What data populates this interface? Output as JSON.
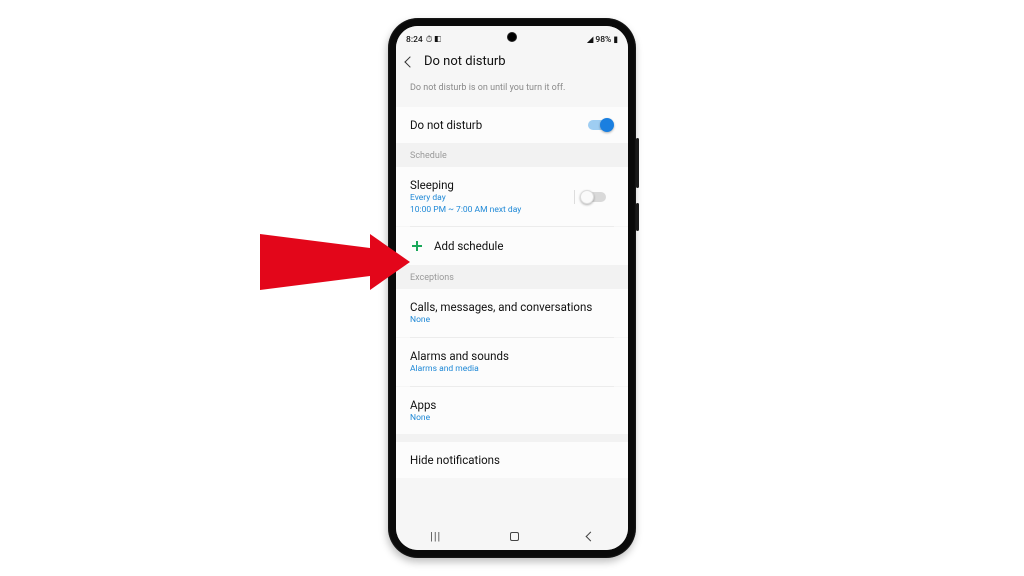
{
  "status": {
    "time": "8:24",
    "icons_left": "⏱ ◧",
    "battery": "98%",
    "icons_right": "⇅ ▮"
  },
  "header": {
    "title": "Do not disturb"
  },
  "subtext": "Do not disturb is on until you turn it off.",
  "dnd": {
    "label": "Do not disturb",
    "on": true
  },
  "sections": {
    "schedule": "Schedule",
    "exceptions": "Exceptions"
  },
  "sleeping": {
    "title": "Sleeping",
    "line1": "Every day",
    "line2": "10:00 PM ~ 7:00 AM next day",
    "on": false
  },
  "add_schedule": "Add schedule",
  "items": {
    "calls": {
      "title": "Calls, messages, and conversations",
      "sub": "None"
    },
    "alarms": {
      "title": "Alarms and sounds",
      "sub": "Alarms and media"
    },
    "apps": {
      "title": "Apps",
      "sub": "None"
    }
  },
  "hide_notifications": "Hide notifications",
  "colors": {
    "accent": "#1a7fe0",
    "link": "#1e88d6",
    "plus": "#1aa85a"
  }
}
